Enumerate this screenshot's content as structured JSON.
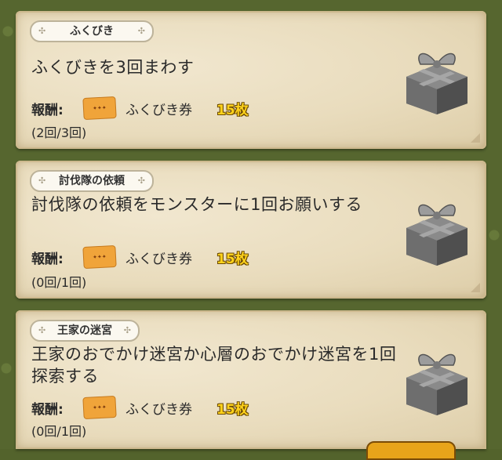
{
  "quests": [
    {
      "category": "ふくびき",
      "title": "ふくびきを3回まわす",
      "reward_label": "報酬:",
      "reward_item_icon": "fukubiki-ticket-icon",
      "reward_name": "ふくびき券",
      "reward_qty": "15枚",
      "progress": "(2回/3回)"
    },
    {
      "category": "討伐隊の依頼",
      "title": "討伐隊の依頼をモンスターに1回お願いする",
      "reward_label": "報酬:",
      "reward_item_icon": "fukubiki-ticket-icon",
      "reward_name": "ふくびき券",
      "reward_qty": "15枚",
      "progress": "(0回/1回)"
    },
    {
      "category": "王家の迷宮",
      "title": "王家のおでかけ迷宮か心層のおでかけ迷宮を1回探索する",
      "reward_label": "報酬:",
      "reward_item_icon": "fukubiki-ticket-icon",
      "reward_name": "ふくびき券",
      "reward_qty": "15枚",
      "progress": "(0回/1回)"
    }
  ],
  "colors": {
    "background": "#56662f",
    "card": "#e9dcbd",
    "qty_text": "#ffd21c",
    "gift_box": "#6b6b6b"
  }
}
